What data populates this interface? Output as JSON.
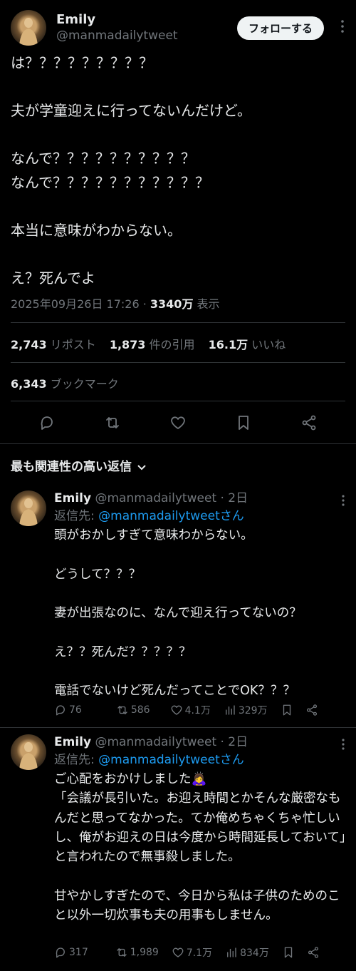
{
  "main": {
    "name": "Emily",
    "handle": "@manmadailytweet",
    "follow_label": "フォローする",
    "text": "は？？？？？？？？？\n\n夫が学童迎えに行ってないんだけど。\n\nなんで？？？？？？？？？？\nなんで？？？？？？？？？？？\n\n本当に意味がわからない。\n\nえ？死んでよ",
    "timestamp": "2025年09月26日 17:26",
    "views_count": "3340万",
    "views_label": "表示",
    "reposts_count": "2,743",
    "reposts_label": "リポスト",
    "quotes_count": "1,873",
    "quotes_label": "件の引用",
    "likes_count": "16.1万",
    "likes_label": "いいね",
    "bookmarks_count": "6,343",
    "bookmarks_label": "ブックマーク"
  },
  "sort_label": "最も関連性の高い返信",
  "replies": [
    {
      "name": "Emily",
      "handle": "@manmadailytweet",
      "age": "· 2日",
      "reply_to_label": "返信先:",
      "reply_to_handle": "@manmadailytweetさん",
      "text": "頭がおかしすぎて意味わからない。\n\nどうして？？？\n\n妻が出張なのに、なんで迎え行ってないの？\n\nえ？？死んだ？？？？？\n\n電話でないけど死んだってことでOK？？？",
      "replies": "76",
      "reposts": "586",
      "likes": "4.1万",
      "views": "329万"
    },
    {
      "name": "Emily",
      "handle": "@manmadailytweet",
      "age": "· 2日",
      "reply_to_label": "返信先:",
      "reply_to_handle": "@manmadailytweetさん",
      "text": "ご心配をおかけしました🙇‍♀️\n「会議が長引いた。お迎え時間とかそんな厳密なもんだと思ってなかった。てか俺めちゃくちゃ忙しいし、俺がお迎えの日は今度から時間延長しておいて」と言われたので無事殺しました。\n\n甘やかしすぎたので、今日から私は子供のためのこと以外一切炊事も夫の用事もしません。",
      "replies": "317",
      "reposts": "1,989",
      "likes": "7.1万",
      "views": "834万"
    }
  ],
  "colors": {
    "background": "#000000",
    "text": "#e7e9ea",
    "muted": "#71767b",
    "link": "#1d9bf0",
    "divider": "#2f3336"
  },
  "icons": [
    "reply-icon",
    "repost-icon",
    "like-icon",
    "bookmark-icon",
    "share-icon",
    "views-icon",
    "more-icon",
    "chevron-down-icon"
  ]
}
